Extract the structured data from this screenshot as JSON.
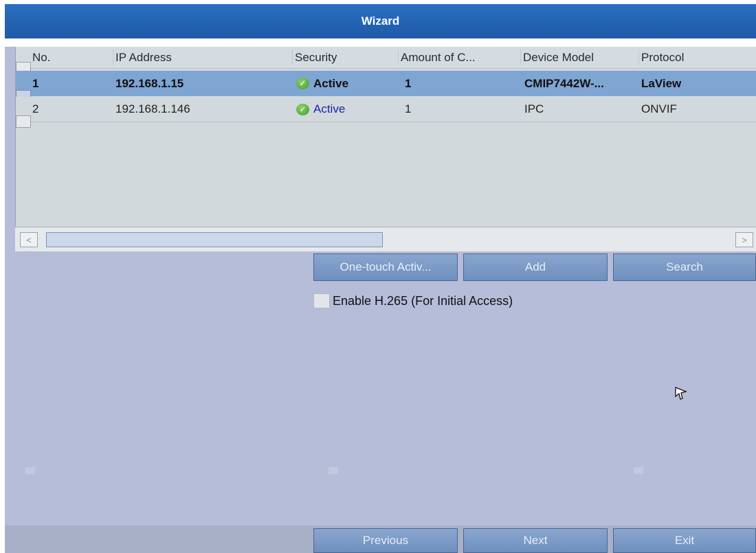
{
  "window": {
    "title": "Wizard"
  },
  "table": {
    "headers": [
      "No.",
      "IP Address",
      "Security",
      "Amount of C...",
      "Device Model",
      "Protocol"
    ],
    "rows": [
      {
        "no": "1",
        "ip": "192.168.1.15",
        "security": "Active",
        "amount": "1",
        "model": "CMIP7442W-...",
        "protocol": "LaView",
        "selected": true
      },
      {
        "no": "2",
        "ip": "192.168.1.146",
        "security": "Active",
        "amount": "1",
        "model": "IPC",
        "protocol": "ONVIF",
        "selected": false
      }
    ]
  },
  "actions": {
    "one_touch": "One-touch Activ...",
    "add": "Add",
    "search": "Search"
  },
  "options": {
    "h265_label": "Enable H.265 (For Initial Access)",
    "h265_checked": false
  },
  "footer": {
    "previous": "Previous",
    "next": "Next",
    "exit": "Exit"
  },
  "icons": {
    "status": "check-circle-icon",
    "scroll_left": "chevron-left-icon",
    "scroll_right": "chevron-right-icon",
    "cursor": "mouse-pointer-icon"
  },
  "colors": {
    "title_bar": "#2a6fc0",
    "selected_row": "#7fa5d3",
    "background": "#b6bdd8",
    "button": "#7b99c6",
    "status_icon": "#4caf3a",
    "active_text_blue": "#1a23a8"
  }
}
